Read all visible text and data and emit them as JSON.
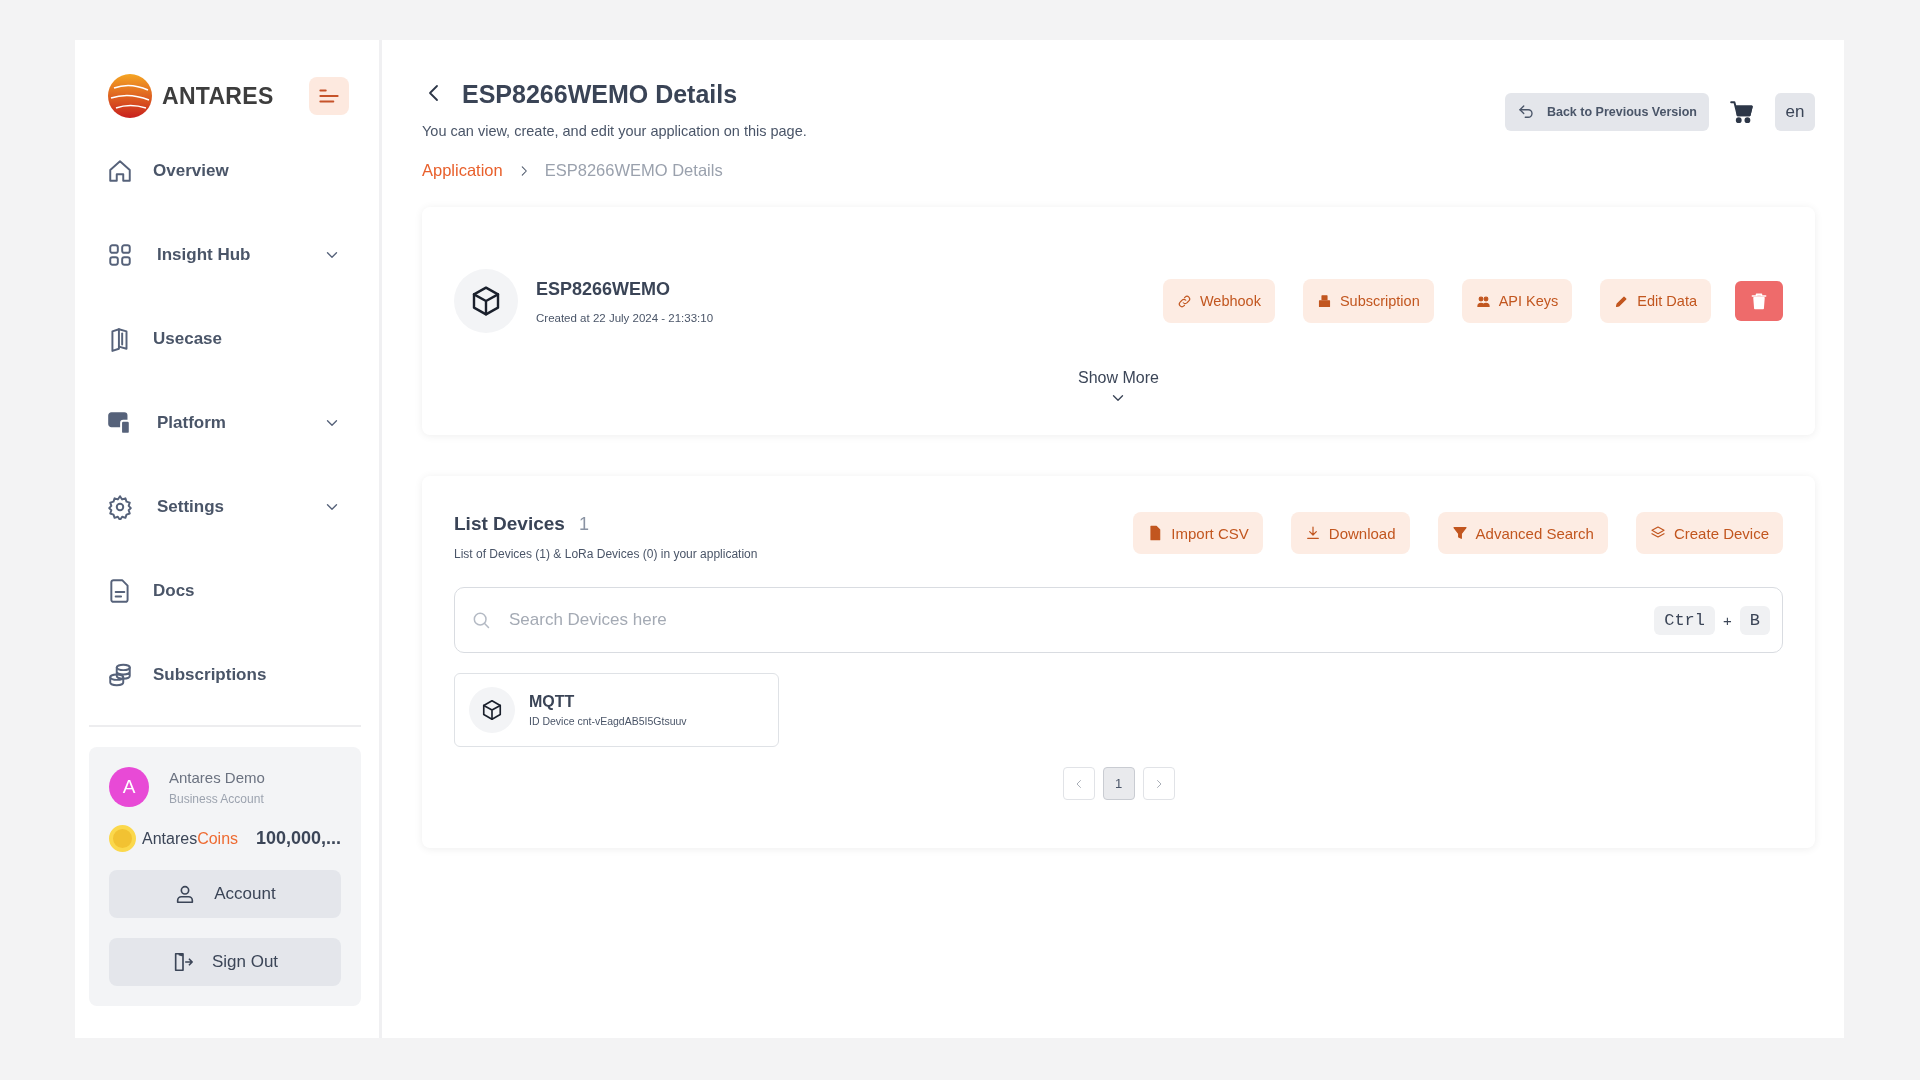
{
  "brand": {
    "name": "ANTARES"
  },
  "nav": [
    {
      "label": "Overview",
      "expandable": false
    },
    {
      "label": "Insight Hub",
      "expandable": true
    },
    {
      "label": "Usecase",
      "expandable": false
    },
    {
      "label": "Platform",
      "expandable": true
    },
    {
      "label": "Settings",
      "expandable": true
    },
    {
      "label": "Docs",
      "expandable": false
    },
    {
      "label": "Subscriptions",
      "expandable": false
    }
  ],
  "account": {
    "avatar_letter": "A",
    "name": "Antares Demo",
    "type": "Business Account",
    "coins_brand": "Antares",
    "coins_suffix": "Coins",
    "coins_amount": "100,000,...",
    "buttons": [
      "Account",
      "Sign Out"
    ]
  },
  "header": {
    "title": "ESP8266WEMO Details",
    "subtitle": "You can view, create, and edit your application on this page.",
    "breadcrumb": [
      "Application",
      "ESP8266WEMO Details"
    ],
    "back_version": "Back to Previous Version",
    "language": "en"
  },
  "application": {
    "name": "ESP8266WEMO",
    "created": "Created at 22 July 2024 - 21:33:10",
    "actions": [
      "Webhook",
      "Subscription",
      "API Keys",
      "Edit Data"
    ],
    "show_more": "Show More"
  },
  "devices": {
    "title": "List Devices",
    "count": "1",
    "summary": "List of Devices (1) & LoRa Devices (0) in your application",
    "actions": [
      "Import CSV",
      "Download",
      "Advanced Search",
      "Create Device"
    ],
    "search_placeholder": "Search Devices here",
    "shortcut": [
      "Ctrl",
      "+",
      "B"
    ],
    "items": [
      {
        "name": "MQTT",
        "id": "ID Device cnt-vEagdAB5I5Gtsuuv"
      }
    ],
    "pages": [
      {
        "label": "1",
        "selected": true
      }
    ]
  }
}
